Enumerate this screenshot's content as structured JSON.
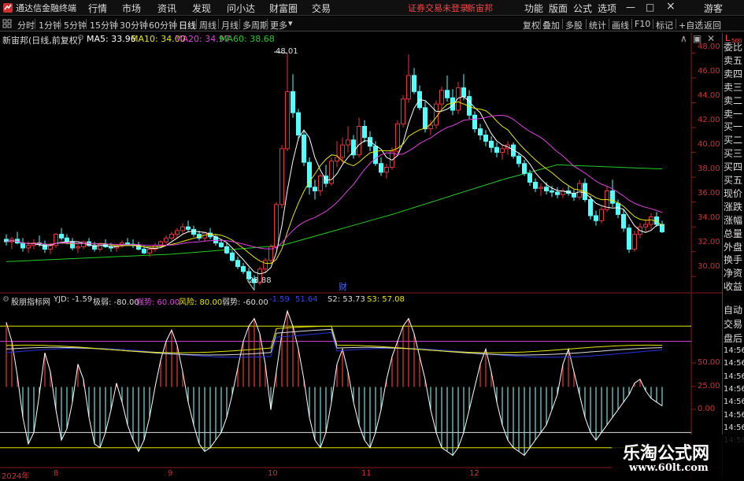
{
  "app": {
    "title": "通达信金融终端"
  },
  "menu": [
    "行情",
    "市场",
    "资讯",
    "发现",
    "问小达",
    "财富圈",
    "交易"
  ],
  "notice": {
    "login": "证券交易未登录",
    "stock": "新宙邦"
  },
  "right_menu": [
    "功能",
    "版面",
    "公式",
    "选项"
  ],
  "window": {
    "minimize": "—",
    "maximize": "□",
    "close": "×",
    "guest": "游客"
  },
  "periods": [
    "分时",
    "1分钟",
    "5分钟",
    "15分钟",
    "30分钟",
    "60分钟",
    "日线",
    "周线",
    "月线",
    "多周期",
    "更多"
  ],
  "tools": [
    "复权",
    "叠加",
    "多股",
    "统计",
    "画线",
    "F10",
    "标记",
    "+自选",
    "返回"
  ],
  "l_indicator": {
    "l": "L",
    "count": "500"
  },
  "main_legend": {
    "title": "新宙邦(日线,前复权)",
    "ma5": "MA5: 33.96",
    "ma10": "MA10: 34.00",
    "ma20": "MA20: 34.97",
    "ma60": "MA60: 38.68"
  },
  "annotations": {
    "high": "48.01",
    "low": "28.88",
    "cai": "财"
  },
  "y_main": [
    "48.00",
    "46.00",
    "44.00",
    "42.00",
    "40.00",
    "38.00",
    "36.00",
    "34.00",
    "32.00",
    "30.00"
  ],
  "sub_legend": {
    "title": "股朋指标网",
    "yjd": "YJD: -1.59",
    "jiruo": "极弱: -80.00",
    "qiangshi": "强势: 60.00",
    "fengxian": "风险: 80.00",
    "ruoshi": "弱势: -60.00",
    "blue": "-1.59",
    "s1": "51.64",
    "s2": "S2: 53.73",
    "s3": "S3: 57.08"
  },
  "y_sub": [
    "50.00",
    "25.00",
    "0.00"
  ],
  "x_labels": [
    "2024年",
    "8",
    "9",
    "10",
    "11",
    "12"
  ],
  "right_panel": [
    "委比",
    "卖五",
    "卖四",
    "卖三",
    "卖二",
    "卖一",
    "买一",
    "买二",
    "买三",
    "买四",
    "买五",
    "现价",
    "涨跌",
    "涨幅",
    "总量",
    "外盘",
    "换手",
    "净资",
    "收益"
  ],
  "right_panel2": [
    "自动",
    "交易",
    "盘后"
  ],
  "times": [
    "14:56",
    "14:56",
    "14:56",
    "14:56",
    "14:56",
    "14:56",
    "14:56",
    "14:56"
  ],
  "watermark": {
    "name": "乐淘公式网",
    "url": "www.60lt.com"
  },
  "colors": {
    "up": "#e8343a",
    "down": "#54ffff",
    "ma5": "#ffffff",
    "ma10": "#e6e600",
    "ma20": "#e040e0",
    "ma60": "#22cc22",
    "blue": "#2233dd"
  },
  "chart_data": {
    "type": "candlestick",
    "title": "",
    "ylim": [
      29,
      48.6
    ],
    "candles": [
      [
        33.0,
        33.4,
        32.5,
        32.8
      ],
      [
        32.8,
        33.2,
        32.2,
        33.0
      ],
      [
        33.0,
        33.6,
        32.6,
        32.7
      ],
      [
        32.7,
        33.1,
        32.0,
        32.3
      ],
      [
        32.3,
        32.8,
        31.9,
        32.5
      ],
      [
        32.5,
        33.0,
        32.2,
        32.7
      ],
      [
        32.7,
        33.3,
        32.4,
        32.6
      ],
      [
        32.6,
        32.9,
        31.9,
        32.2
      ],
      [
        32.2,
        32.7,
        31.8,
        32.5
      ],
      [
        32.5,
        33.5,
        32.3,
        33.4
      ],
      [
        33.4,
        33.9,
        32.9,
        33.1
      ],
      [
        33.1,
        33.4,
        32.6,
        32.8
      ],
      [
        32.8,
        33.1,
        32.1,
        32.3
      ],
      [
        32.3,
        32.6,
        31.9,
        32.4
      ],
      [
        32.4,
        32.9,
        32.2,
        32.8
      ],
      [
        32.8,
        33.1,
        32.4,
        32.5
      ],
      [
        32.5,
        32.8,
        32.0,
        32.2
      ],
      [
        32.2,
        32.7,
        32.0,
        32.6
      ],
      [
        32.6,
        33.0,
        32.3,
        32.4
      ],
      [
        32.4,
        32.7,
        32.0,
        32.3
      ],
      [
        32.3,
        32.6,
        32.0,
        32.5
      ],
      [
        32.5,
        32.9,
        32.3,
        32.7
      ],
      [
        32.7,
        33.1,
        32.5,
        32.6
      ],
      [
        32.6,
        33.0,
        32.3,
        32.5
      ],
      [
        32.5,
        32.8,
        32.1,
        32.2
      ],
      [
        32.2,
        32.5,
        31.8,
        31.9
      ],
      [
        31.9,
        32.3,
        31.6,
        32.2
      ],
      [
        32.2,
        32.7,
        32.0,
        32.5
      ],
      [
        32.5,
        32.9,
        32.3,
        32.8
      ],
      [
        32.8,
        33.3,
        32.6,
        33.1
      ],
      [
        33.1,
        33.6,
        32.9,
        33.4
      ],
      [
        33.4,
        33.9,
        33.1,
        33.7
      ],
      [
        33.7,
        34.3,
        33.4,
        34.0
      ],
      [
        34.0,
        34.5,
        33.6,
        33.8
      ],
      [
        33.8,
        34.1,
        33.2,
        33.4
      ],
      [
        33.4,
        33.7,
        32.9,
        33.1
      ],
      [
        33.1,
        33.6,
        32.8,
        33.5
      ],
      [
        33.5,
        33.9,
        33.0,
        33.2
      ],
      [
        33.2,
        33.4,
        32.5,
        32.7
      ],
      [
        32.7,
        33.0,
        32.3,
        32.4
      ],
      [
        32.4,
        32.7,
        31.8,
        31.9
      ],
      [
        31.9,
        32.1,
        31.2,
        31.3
      ],
      [
        31.3,
        31.6,
        30.6,
        30.8
      ],
      [
        30.8,
        31.1,
        30.2,
        30.4
      ],
      [
        30.4,
        30.7,
        29.6,
        29.8
      ],
      [
        29.8,
        30.1,
        28.9,
        29.5
      ],
      [
        29.5,
        30.8,
        29.3,
        30.6
      ],
      [
        30.6,
        31.5,
        30.3,
        31.3
      ],
      [
        31.3,
        32.6,
        31.1,
        32.4
      ],
      [
        32.4,
        36.0,
        32.2,
        35.8
      ],
      [
        35.8,
        40.6,
        35.5,
        40.3
      ],
      [
        40.3,
        48.0,
        40.1,
        44.9
      ],
      [
        44.9,
        46.3,
        42.8,
        43.2
      ],
      [
        43.2,
        43.5,
        41.0,
        41.4
      ],
      [
        41.4,
        41.8,
        38.9,
        39.2
      ],
      [
        39.2,
        39.6,
        36.6,
        37.2
      ],
      [
        37.2,
        37.8,
        36.2,
        36.9
      ],
      [
        36.9,
        38.3,
        36.5,
        38.1
      ],
      [
        38.1,
        39.0,
        37.2,
        37.5
      ],
      [
        37.5,
        39.6,
        37.3,
        39.3
      ],
      [
        39.3,
        40.9,
        38.8,
        39.6
      ],
      [
        39.6,
        41.2,
        39.1,
        40.6
      ],
      [
        40.6,
        42.1,
        40.0,
        41.0
      ],
      [
        41.0,
        41.4,
        39.5,
        39.8
      ],
      [
        39.8,
        42.8,
        39.6,
        42.1
      ],
      [
        42.1,
        42.6,
        40.8,
        41.2
      ],
      [
        41.2,
        41.7,
        40.1,
        40.5
      ],
      [
        40.5,
        40.9,
        38.9,
        39.1
      ],
      [
        39.1,
        39.6,
        38.1,
        38.4
      ],
      [
        38.4,
        39.1,
        37.9,
        38.8
      ],
      [
        38.8,
        40.4,
        38.6,
        40.1
      ],
      [
        40.1,
        42.6,
        39.9,
        42.3
      ],
      [
        42.3,
        44.6,
        42.0,
        44.3
      ],
      [
        44.3,
        47.9,
        44.0,
        46.2
      ],
      [
        46.2,
        46.8,
        44.7,
        44.9
      ],
      [
        44.9,
        45.4,
        43.4,
        43.6
      ],
      [
        43.6,
        44.1,
        41.6,
        41.9
      ],
      [
        41.9,
        42.6,
        41.4,
        42.2
      ],
      [
        42.2,
        44.2,
        41.9,
        43.9
      ],
      [
        43.9,
        45.3,
        43.5,
        45.0
      ],
      [
        45.0,
        46.2,
        44.1,
        44.4
      ],
      [
        44.4,
        45.1,
        43.0,
        43.4
      ],
      [
        43.4,
        45.7,
        43.1,
        45.2
      ],
      [
        45.2,
        46.3,
        44.2,
        44.5
      ],
      [
        44.5,
        45.0,
        42.7,
        43.0
      ],
      [
        43.0,
        43.3,
        41.6,
        41.9
      ],
      [
        41.9,
        42.3,
        41.0,
        41.4
      ],
      [
        41.4,
        41.8,
        40.5,
        40.9
      ],
      [
        40.9,
        41.3,
        40.0,
        40.4
      ],
      [
        40.4,
        40.8,
        39.6,
        40.0
      ],
      [
        40.0,
        40.6,
        39.4,
        40.3
      ],
      [
        40.3,
        40.9,
        39.8,
        40.6
      ],
      [
        40.6,
        40.8,
        39.5,
        39.7
      ],
      [
        39.7,
        40.0,
        38.8,
        39.1
      ],
      [
        39.1,
        39.4,
        38.1,
        38.3
      ],
      [
        38.3,
        38.6,
        37.3,
        37.6
      ],
      [
        37.6,
        37.9,
        36.8,
        37.1
      ],
      [
        37.1,
        37.5,
        36.5,
        37.2
      ],
      [
        37.2,
        37.6,
        36.6,
        36.9
      ],
      [
        36.9,
        37.3,
        36.4,
        36.8
      ],
      [
        36.8,
        37.2,
        36.3,
        36.6
      ],
      [
        36.6,
        37.1,
        36.3,
        36.9
      ],
      [
        36.9,
        37.3,
        36.5,
        36.7
      ],
      [
        36.7,
        37.0,
        36.1,
        36.4
      ],
      [
        36.4,
        37.8,
        36.2,
        37.5
      ],
      [
        37.5,
        37.9,
        36.0,
        36.2
      ],
      [
        36.2,
        36.5,
        34.6,
        34.9
      ],
      [
        34.9,
        35.3,
        34.1,
        34.5
      ],
      [
        34.5,
        35.6,
        34.3,
        35.4
      ],
      [
        35.4,
        37.3,
        35.2,
        36.9
      ],
      [
        36.9,
        37.8,
        35.6,
        35.9
      ],
      [
        35.9,
        36.2,
        34.7,
        35.0
      ],
      [
        35.0,
        35.4,
        33.6,
        33.9
      ],
      [
        33.9,
        34.2,
        31.9,
        32.2
      ],
      [
        32.2,
        33.7,
        32.0,
        33.4
      ],
      [
        33.4,
        34.3,
        33.1,
        34.0
      ],
      [
        34.0,
        34.6,
        33.6,
        34.2
      ],
      [
        34.2,
        35.1,
        33.8,
        34.8
      ],
      [
        34.8,
        35.2,
        34.0,
        34.2
      ],
      [
        34.2,
        34.5,
        33.5,
        33.6
      ]
    ],
    "ma60_anchor": [
      [
        0,
        31.2
      ],
      [
        30,
        31.8
      ],
      [
        50,
        32.5
      ],
      [
        70,
        35.0
      ],
      [
        90,
        37.8
      ],
      [
        100,
        39.0
      ],
      [
        118,
        38.68
      ]
    ]
  }
}
